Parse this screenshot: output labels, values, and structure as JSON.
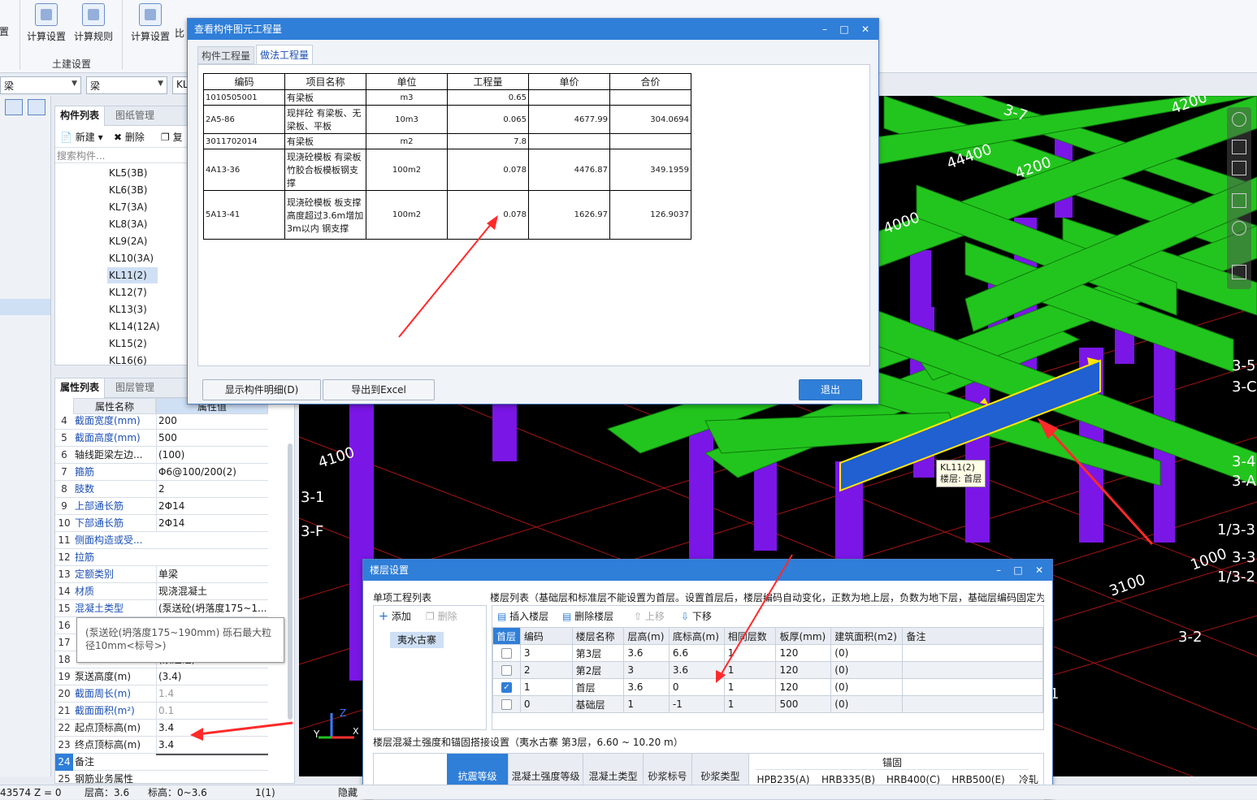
{
  "ribbon": {
    "btn_cut": "置",
    "btn_calc_settings": "计算设置",
    "btn_calc_rules": "计算规则",
    "btn_calc_settings2": "计算设置",
    "btn_partial": "比",
    "group_label": "土建设置"
  },
  "combos": {
    "floor": "梁",
    "type": "梁",
    "name": "KL"
  },
  "component_panel": {
    "tab_list": "构件列表",
    "tab_drawings": "图纸管理",
    "new_label": "新建",
    "delete_label": "删除",
    "copy_label": "复",
    "search_placeholder": "搜索构件...",
    "items": [
      "KL5(3B)",
      "KL6(3B)",
      "KL7(3A)",
      "KL8(3A)",
      "KL9(2A)",
      "KL10(3A)",
      "KL11(2)",
      "KL12(7)",
      "KL13(3)",
      "KL14(12A)",
      "KL15(2)",
      "KL16(6)"
    ]
  },
  "props_panel": {
    "tab_props": "属性列表",
    "tab_layers": "图层管理",
    "col_name": "属性名称",
    "col_value": "属性值",
    "rows": [
      {
        "n": "4",
        "k": "截面宽度(mm)",
        "v": "200",
        "blue": true
      },
      {
        "n": "5",
        "k": "截面高度(mm)",
        "v": "500",
        "blue": true
      },
      {
        "n": "6",
        "k": "轴线距梁左边...",
        "v": "(100)",
        "blue": false
      },
      {
        "n": "7",
        "k": "箍筋",
        "v": "Φ6@100/200(2)",
        "blue": true
      },
      {
        "n": "8",
        "k": "肢数",
        "v": "2",
        "blue": true
      },
      {
        "n": "9",
        "k": "上部通长筋",
        "v": "2Φ14",
        "blue": true
      },
      {
        "n": "10",
        "k": "下部通长筋",
        "v": "2Φ14",
        "blue": true
      },
      {
        "n": "11",
        "k": "侧面构造或受...",
        "v": "",
        "blue": true
      },
      {
        "n": "12",
        "k": "拉筋",
        "v": "",
        "blue": true
      },
      {
        "n": "13",
        "k": "定额类别",
        "v": "单梁",
        "blue": true
      },
      {
        "n": "14",
        "k": "材质",
        "v": "现浇混凝土",
        "blue": true
      },
      {
        "n": "15",
        "k": "混凝土类型",
        "v": "(泵送砼(坍落度175~1...",
        "blue": true
      },
      {
        "n": "16",
        "k": "",
        "v": "",
        "blue": false
      },
      {
        "n": "17",
        "k": "",
        "v": "",
        "blue": false
      },
      {
        "n": "18",
        "k": "",
        "v": "(泵送砼)",
        "blue": false
      },
      {
        "n": "19",
        "k": "泵送高度(m)",
        "v": "(3.4)",
        "blue": false
      },
      {
        "n": "20",
        "k": "截面周长(m)",
        "v": "1.4",
        "blue": true,
        "gray": true
      },
      {
        "n": "21",
        "k": "截面面积(m²)",
        "v": "0.1",
        "blue": true,
        "gray": true
      },
      {
        "n": "22",
        "k": "起点顶标高(m)",
        "v": "3.4",
        "blue": false
      },
      {
        "n": "23",
        "k": "终点顶标高(m)",
        "v": "3.4",
        "blue": false
      },
      {
        "n": "24",
        "k": "备注",
        "v": "",
        "blue": false
      },
      {
        "n": "25",
        "k": "钢筋业务属性",
        "v": "",
        "blue": false
      }
    ],
    "tooltip": "(泵送砼(坍落度175~190mm) 砾石最大粒径10mm<标号>)"
  },
  "qty_dialog": {
    "title": "查看构件图元工程量",
    "tab_component": "构件工程量",
    "tab_method": "做法工程量",
    "headers": [
      "编码",
      "项目名称",
      "单位",
      "工程量",
      "单价",
      "合价"
    ],
    "rows": [
      {
        "i": "1",
        "code": "010505001",
        "name": "有梁板",
        "unit": "m3",
        "qty": "0.65",
        "price": "",
        "total": ""
      },
      {
        "i": "2",
        "code": "A5-86",
        "name": "现拌砼 有梁板、无梁板、平板",
        "unit": "10m3",
        "qty": "0.065",
        "price": "4677.99",
        "total": "304.0694"
      },
      {
        "i": "3",
        "code": "011702014",
        "name": "有梁板",
        "unit": "m2",
        "qty": "7.8",
        "price": "",
        "total": ""
      },
      {
        "i": "4",
        "code": "A13-36",
        "name": "现浇砼模板 有梁板 竹胶合板模板钢支撑",
        "unit": "100m2",
        "qty": "0.078",
        "price": "4476.87",
        "total": "349.1959"
      },
      {
        "i": "5",
        "code": "A13-41",
        "name": "现浇砼模板 板支撑高度超过3.6m增加3m以内 钢支撑",
        "unit": "100m2",
        "qty": "0.078",
        "price": "1626.97",
        "total": "126.9037"
      }
    ],
    "btn_detail": "显示构件明细(D)",
    "btn_export": "导出到Excel",
    "btn_exit": "退出"
  },
  "viewport": {
    "labels": [
      "3-7",
      "4200",
      "44400",
      "4200",
      "4000",
      "4100",
      "3-1",
      "3-F",
      "3-5",
      "3-C",
      "3-4",
      "3-A",
      "1/3-3",
      "1000",
      "3-3",
      "1/3-2",
      "3100",
      "3-2",
      "1"
    ],
    "tooltip_name": "KL11(2)",
    "tooltip_floor": "楼层: 首层"
  },
  "floor_dialog": {
    "title": "楼层设置",
    "project_list_label": "单项工程列表",
    "add_label": "添加",
    "delete_label": "删除",
    "project_name": "夷水古寨",
    "floor_list_label": "楼层列表（基础层和标准层不能设置为首层。设置首层后，楼层编码自动变化，正数为地上层，负数为地下层，基础层编码固定为",
    "insert_label": "插入楼层",
    "remove_label": "删除楼层",
    "up_label": "上移",
    "down_label": "下移",
    "headers": [
      "首层",
      "编码",
      "楼层名称",
      "层高(m)",
      "底标高(m)",
      "相同层数",
      "板厚(mm)",
      "建筑面积(m2)",
      "备注"
    ],
    "rows": [
      {
        "first": false,
        "code": "3",
        "name": "第3层",
        "h": "3.6",
        "bottom": "6.6",
        "same": "1",
        "slab": "120",
        "area": "(0)",
        "note": ""
      },
      {
        "first": false,
        "code": "2",
        "name": "第2层",
        "h": "3",
        "bottom": "3.6",
        "same": "1",
        "slab": "120",
        "area": "(0)",
        "note": ""
      },
      {
        "first": true,
        "code": "1",
        "name": "首层",
        "h": "3.6",
        "bottom": "0",
        "same": "1",
        "slab": "120",
        "area": "(0)",
        "note": ""
      },
      {
        "first": false,
        "code": "0",
        "name": "基础层",
        "h": "1",
        "bottom": "-1",
        "same": "1",
        "slab": "500",
        "area": "(0)",
        "note": ""
      }
    ],
    "strength_label": "楼层混凝土强度和锚固搭接设置（夷水古寨 第3层，6.60 ~ 10.20 m）",
    "strength_headers": [
      "抗震等级",
      "混凝土强度等级",
      "混凝土类型",
      "砂浆标号",
      "砂浆类型"
    ],
    "anchor_label": "锚固",
    "anchor_headers": [
      "HPB235(A)",
      "HRB335(B)",
      "HRB400(C)",
      "HRB500(E)",
      "冷轧"
    ]
  },
  "statusbar": {
    "coord": "43574 Z = 0",
    "floor_height": "层高：3.6",
    "elevation": "标高：0~3.6",
    "count": "1(1)",
    "hidden": "隐藏"
  },
  "colors": {
    "accent": "#2f7ed8",
    "beam": "#22c51d",
    "column": "#7a16e6",
    "selected": "#2060d0",
    "arrow": "#ff2a2a",
    "axis": "#ff2020"
  }
}
